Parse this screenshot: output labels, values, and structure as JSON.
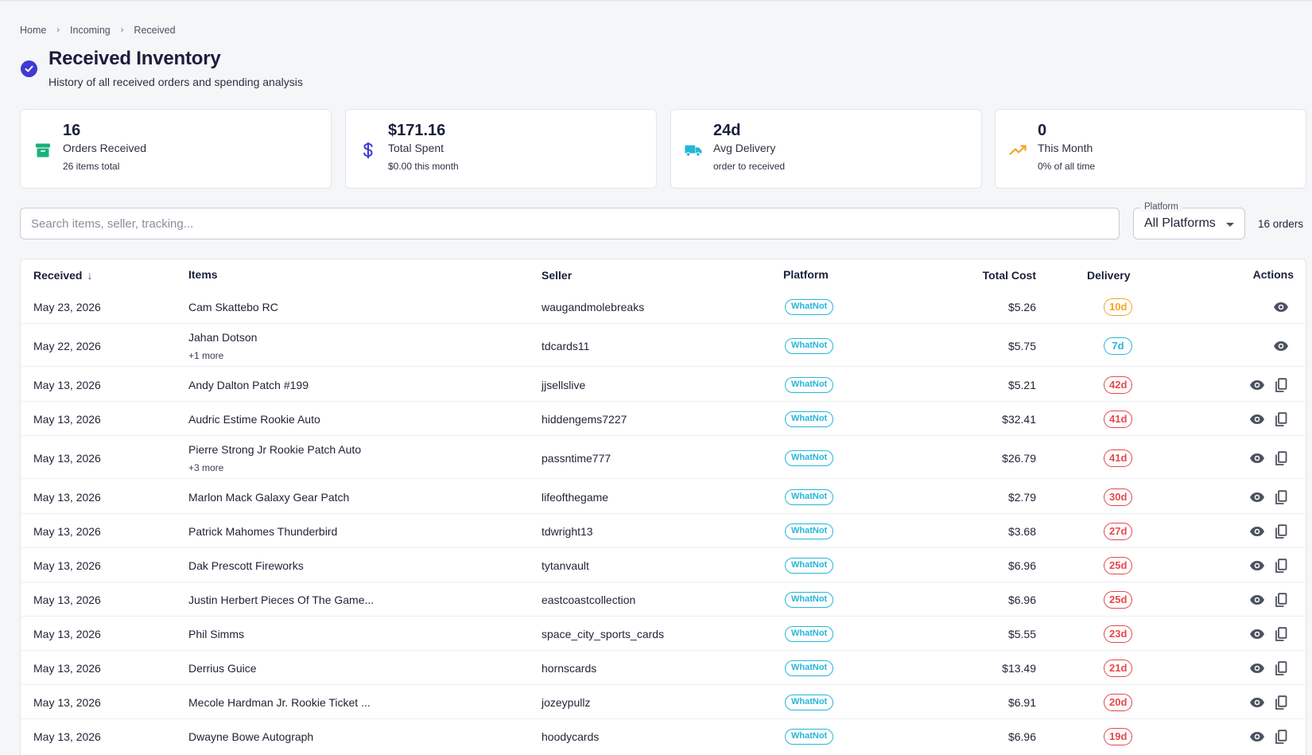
{
  "breadcrumb": {
    "items": [
      "Home",
      "Incoming",
      "Received"
    ],
    "sep": "›"
  },
  "header": {
    "title": "Received Inventory",
    "subtitle": "History of all received orders and spending analysis",
    "icon": "check-circle-icon",
    "accent": "#3f3ad0"
  },
  "stats": [
    {
      "value": "16",
      "label": "Orders Received",
      "sub": "26 items total",
      "icon": "archive-icon",
      "color": "#18b27a"
    },
    {
      "value": "$171.16",
      "label": "Total Spent",
      "sub": "$0.00 this month",
      "icon": "dollar-icon",
      "color": "#3f3ad0"
    },
    {
      "value": "24d",
      "label": "Avg Delivery",
      "sub": "order to received",
      "icon": "truck-icon",
      "color": "#26b6d9"
    },
    {
      "value": "0",
      "label": "This Month",
      "sub": "0% of all time",
      "icon": "trending-up-icon",
      "color": "#f3a423"
    }
  ],
  "search": {
    "placeholder": "Search items, seller, tracking..."
  },
  "platform_filter": {
    "label": "Platform",
    "value": "All Platforms"
  },
  "order_count": "16 orders",
  "table": {
    "columns": {
      "received": "Received",
      "items": "Items",
      "seller": "Seller",
      "platform": "Platform",
      "total_cost": "Total Cost",
      "delivery": "Delivery",
      "actions": "Actions"
    },
    "sort_arrow": "↓",
    "rows": [
      {
        "received": "May 23, 2026",
        "item": "Cam Skattebo RC",
        "more": "",
        "seller": "waugandmolebreaks",
        "platform": "WhatNot",
        "cost": "$5.26",
        "delivery": "10d",
        "status": "orange",
        "copy": false
      },
      {
        "received": "May 22, 2026",
        "item": "Jahan Dotson",
        "more": "+1 more",
        "seller": "tdcards11",
        "platform": "WhatNot",
        "cost": "$5.75",
        "delivery": "7d",
        "status": "blue",
        "copy": false
      },
      {
        "received": "May 13, 2026",
        "item": "Andy Dalton Patch #199",
        "more": "",
        "seller": "jjsellslive",
        "platform": "WhatNot",
        "cost": "$5.21",
        "delivery": "42d",
        "status": "red",
        "copy": true
      },
      {
        "received": "May 13, 2026",
        "item": "Audric Estime Rookie Auto",
        "more": "",
        "seller": "hiddengems7227",
        "platform": "WhatNot",
        "cost": "$32.41",
        "delivery": "41d",
        "status": "red",
        "copy": true
      },
      {
        "received": "May 13, 2026",
        "item": "Pierre Strong Jr Rookie Patch Auto",
        "more": "+3 more",
        "seller": "passntime777",
        "platform": "WhatNot",
        "cost": "$26.79",
        "delivery": "41d",
        "status": "red",
        "copy": true
      },
      {
        "received": "May 13, 2026",
        "item": "Marlon Mack Galaxy Gear Patch",
        "more": "",
        "seller": "lifeofthegame",
        "platform": "WhatNot",
        "cost": "$2.79",
        "delivery": "30d",
        "status": "red",
        "copy": true
      },
      {
        "received": "May 13, 2026",
        "item": "Patrick Mahomes Thunderbird",
        "more": "",
        "seller": "tdwright13",
        "platform": "WhatNot",
        "cost": "$3.68",
        "delivery": "27d",
        "status": "red",
        "copy": true
      },
      {
        "received": "May 13, 2026",
        "item": "Dak Prescott Fireworks",
        "more": "",
        "seller": "tytanvault",
        "platform": "WhatNot",
        "cost": "$6.96",
        "delivery": "25d",
        "status": "red",
        "copy": true
      },
      {
        "received": "May 13, 2026",
        "item": "Justin Herbert Pieces Of The Game...",
        "more": "",
        "seller": "eastcoastcollection",
        "platform": "WhatNot",
        "cost": "$6.96",
        "delivery": "25d",
        "status": "red",
        "copy": true
      },
      {
        "received": "May 13, 2026",
        "item": "Phil Simms",
        "more": "",
        "seller": "space_city_sports_cards",
        "platform": "WhatNot",
        "cost": "$5.55",
        "delivery": "23d",
        "status": "red",
        "copy": true
      },
      {
        "received": "May 13, 2026",
        "item": "Derrius Guice",
        "more": "",
        "seller": "hornscards",
        "platform": "WhatNot",
        "cost": "$13.49",
        "delivery": "21d",
        "status": "red",
        "copy": true
      },
      {
        "received": "May 13, 2026",
        "item": "Mecole Hardman Jr. Rookie Ticket ...",
        "more": "",
        "seller": "jozeypullz",
        "platform": "WhatNot",
        "cost": "$6.91",
        "delivery": "20d",
        "status": "red",
        "copy": true
      },
      {
        "received": "May 13, 2026",
        "item": "Dwayne Bowe Autograph",
        "more": "",
        "seller": "hoodycards",
        "platform": "WhatNot",
        "cost": "$6.96",
        "delivery": "19d",
        "status": "red",
        "copy": true
      }
    ]
  },
  "colors": {
    "orange": "#f3a423",
    "blue": "#26b6d9",
    "red": "#e5484d",
    "platform": "#26b6d9"
  }
}
